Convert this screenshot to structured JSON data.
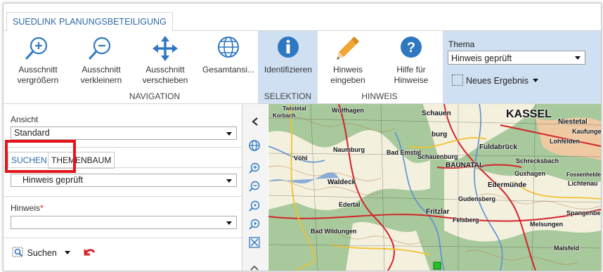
{
  "app": {
    "tab_title": "SUEDLINK PLANUNGSBETEILIGUNG"
  },
  "ribbon": {
    "buttons": [
      {
        "line1": "Ausschnitt",
        "line2": "vergrößern",
        "icon": "zoom-in-icon"
      },
      {
        "line1": "Ausschnitt",
        "line2": "verkleinern",
        "icon": "zoom-out-icon"
      },
      {
        "line1": "Ausschnitt",
        "line2": "verschieben",
        "icon": "move-icon"
      },
      {
        "line1": "Gesamtansi...",
        "line2": "",
        "icon": "globe-icon"
      },
      {
        "line1": "Identifizieren",
        "line2": "",
        "icon": "info-icon"
      },
      {
        "line1": "Hinweis",
        "line2": "eingeben",
        "icon": "pencil-icon"
      },
      {
        "line1": "Hilfe für",
        "line2": "Hinweise",
        "icon": "help-icon"
      }
    ],
    "groups": {
      "navigation": "NAVIGATION",
      "selektion": "SELEKTION",
      "hinweis": "HINWEIS"
    },
    "thema": {
      "label": "Thema",
      "value": "Hinweis geprüft",
      "new_result": "Neues Ergebnis"
    }
  },
  "left_panel": {
    "ansicht_label": "Ansicht",
    "ansicht_value": "Standard",
    "tabs": [
      "SUCHEN",
      "THEMENBAUM"
    ],
    "search_layer": "Hinweis geprüft",
    "hinweis_label": "Hinweis",
    "hinweis_required": "*",
    "hinweis_value": "",
    "search_button": "Suchen"
  },
  "map": {
    "places": [
      "KASSEL",
      "Wolfhagen",
      "Schauen",
      "Niestetal",
      "Kaufunge",
      "Lohfelden",
      "burg",
      "Fuldabrück",
      "Naumburg",
      "Bad Emstal",
      "Schauenburg",
      "BAUNATAL",
      "Schrecksbach",
      "Vöhl",
      "Waldeck",
      "Edermünde",
      "Guxhagen",
      "Fossenhelde",
      "Lichtenau",
      "Edertal",
      "Gudensberg",
      "Felsberg",
      "Fritzlar",
      "Melsungen",
      "Bad Wildungen",
      "Spangenberg",
      "Malsfeld",
      "Korbach",
      "Twistetal"
    ],
    "colors": {
      "forest": "#8fbf7f",
      "field": "#f3f0de",
      "road_red": "#d3242a",
      "road_yellow": "#f2c230",
      "water": "#5c8fd4",
      "contour": "#b56a3c"
    }
  },
  "colors": {
    "accent": "#2b6aa6",
    "selection_bg": "#cfe0f2",
    "highlight_red": "#e4141b"
  }
}
